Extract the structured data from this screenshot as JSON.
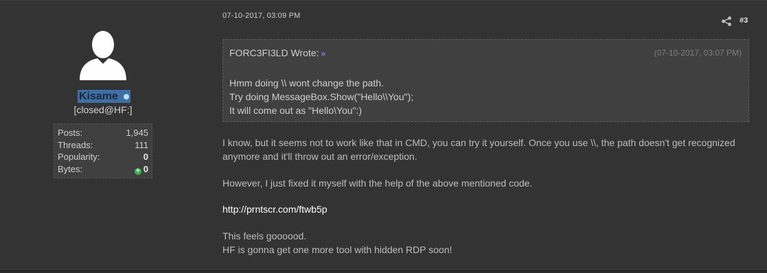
{
  "user": {
    "username": "Kisame",
    "usertitle": "[closed@HF:]",
    "stats": [
      {
        "label": "Posts:",
        "value": "1,945",
        "bold": false
      },
      {
        "label": "Threads:",
        "value": "111",
        "bold": false
      },
      {
        "label": "Popularity:",
        "value": "0",
        "bold": true
      },
      {
        "label": "Bytes:",
        "value": "0",
        "bold": true,
        "icon": "plus-circle-icon"
      }
    ]
  },
  "post": {
    "date": "07-10-2017, 03:09 PM",
    "number": "#3",
    "quote": {
      "author": "FORC3FI3LD Wrote:",
      "arrow": "»",
      "date": "(07-10-2017, 03:07 PM)",
      "lines": [
        "Hmm doing \\\\ wont change the path.",
        "Try doing MessageBox.Show(\"Hello\\\\You\");",
        "It will come out as \"Hello\\You\":)"
      ]
    },
    "message": {
      "p1": "I know, but it seems not to work like that in CMD, you can try it yourself. Once you use \\\\, the path doesn't get recognized anymore and it'll throw out an error/exception.",
      "p2": "However, I just fixed it myself with the help of the above mentioned code.",
      "link": "http://prntscr.com/ftwb5p",
      "p4_line1": "This feels goooood.",
      "p4_line2": "HF is gonna get one more tool with hidden RDP soon!"
    }
  },
  "colors": {
    "background": "#333333",
    "username_highlight": "#3f6fa6",
    "quote_bg": "#404040",
    "arrow": "#8c7ce0",
    "bytes_plus": "#3bb34a"
  }
}
